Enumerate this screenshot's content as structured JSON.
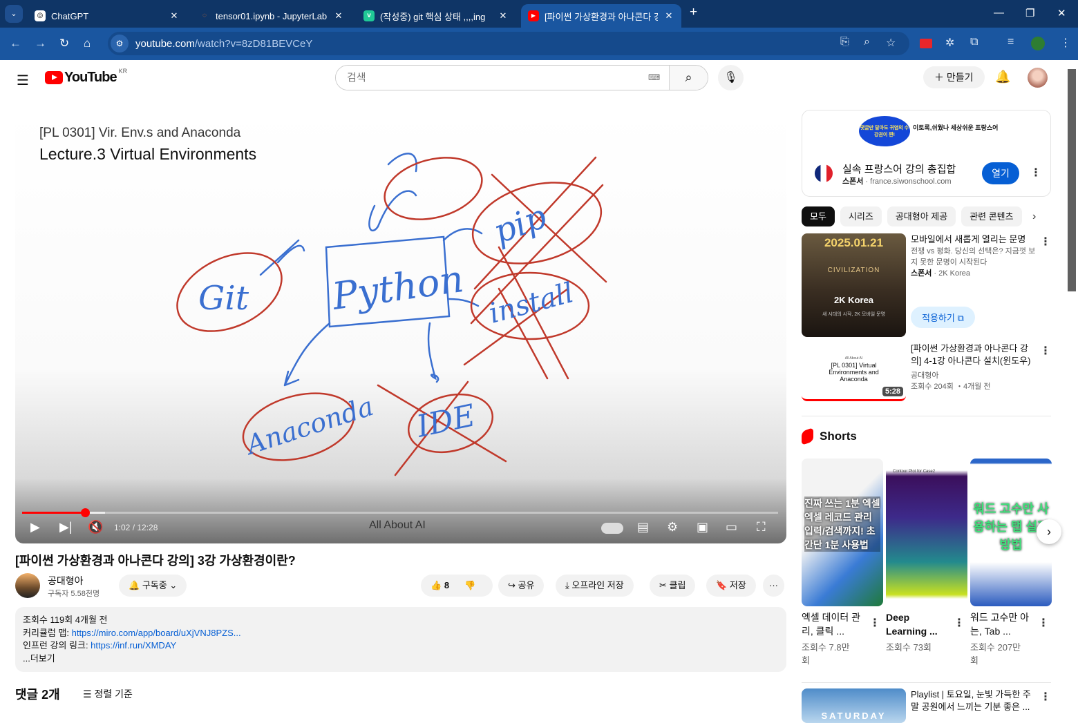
{
  "browser": {
    "tabs": [
      {
        "title": "ChatGPT",
        "close": "✕"
      },
      {
        "title": "tensor01.ipynb - JupyterLab",
        "close": "✕"
      },
      {
        "title": "(작성중) git 핵심 상태 ,,,,ing",
        "close": "✕"
      },
      {
        "title": "[파이썬 가상환경과 아나콘다 강",
        "close": "✕"
      }
    ],
    "new_tab": "+",
    "url_host": "youtube.com",
    "url_path": "/watch?v=8zD81BEVCeY"
  },
  "youtube": {
    "logo_text": "YouTube",
    "region": "KR",
    "search_placeholder": "검색",
    "create_label": "만들기"
  },
  "video": {
    "slide_subtitle": "[PL 0301] Vir. Env.s and Anaconda",
    "slide_title": "Lecture.3 Virtual Environments",
    "annotations": {
      "git": "Git",
      "python": "Python",
      "pip": "pip",
      "install": "install",
      "anaconda": "Anaconda",
      "ide": "IDE"
    },
    "progress_fraction": 0.083,
    "buffered_fraction": 0.11,
    "time": "1:02 / 12:28",
    "channel_watermark": "All About AI",
    "title": "[파이썬 가상환경과 아나콘다 강의] 3강 가상환경이란?",
    "channel": "공대형아",
    "subscribers": "구독자 5.58천명",
    "subscribe_label": "구독중",
    "likes": "8",
    "share": "공유",
    "download": "오프라인 저장",
    "clip": "클립",
    "save": "저장",
    "more": "···"
  },
  "description": {
    "stats": "조회수 119회  4개월 전",
    "line1_label": "커리큘럼 맵: ",
    "line1_link": "https://miro.com/app/board/uXjVNJ8PZS...",
    "line2_label": "인프런 강의 링크: ",
    "line2_link": "https://inf.run/XMDAY",
    "more": "...더보기"
  },
  "comments": {
    "count": "댓글 2개",
    "sort": "정렬 기준"
  },
  "ad": {
    "banner1": "댓글만 달아도 귀염의 수강권이 쨘!",
    "banner2": "이토록,쉬웠나 세상쉬운 프랑스어",
    "title": "실속 프랑스어 강의 총집합",
    "sponsor": "스폰서",
    "domain": "france.siwonschool.com",
    "open": "열기"
  },
  "chips": [
    "모두",
    "시리즈",
    "공대형아 제공",
    "관련 콘텐츠"
  ],
  "recommendations": [
    {
      "title": "모바일에서 새롭게 열리는 문명",
      "desc": "전쟁 vs 평화. 당신의 선택은? 지금껏 보지 못한 문명이 시작된다",
      "sponsor": "스폰서",
      "channel": "2K Korea",
      "cta": "적용하기",
      "thumb_date": "2025.01.21",
      "thumb_brand": "2K Korea",
      "thumb_caption": "새 시대의 시작, 2K 모바일 문명",
      "thumb_game": "CIVILIZATION"
    },
    {
      "title": "[파이썬 가상환경과 아나콘다 강의] 4-1강 아나콘다 설치(윈도우)",
      "channel": "공대형아",
      "meta": "조회수 204회 ・4개월 전",
      "duration": "5:28",
      "thumb_top": "All About AI",
      "thumb_text": "[PL 0301] Virtual Environments and Anaconda"
    }
  ],
  "shorts": {
    "heading": "Shorts",
    "items": [
      {
        "title": "엑셀 데이터 관리, 클릭 ...",
        "views": "조회수 7.8만회",
        "thumb": "진짜 쓰는 1분 엑셀 엑셀 레코드 관리 입력/검색까지! 초간단 1분 사용법"
      },
      {
        "title": "Deep Learning ...",
        "views": "조회수 73회",
        "thumb": "Contour Plot for Case2"
      },
      {
        "title": "워드 고수만 아는, Tab ...",
        "views": "조회수 207만회",
        "thumb": "워드 고수만 사용하는 탭 설정 방법"
      }
    ]
  },
  "playlist": {
    "title": "Playlist | 토요일, 눈빛 가득한 주말 공원에서 느끼는 기분 좋은 ...",
    "thumb": "SATURDAY"
  }
}
